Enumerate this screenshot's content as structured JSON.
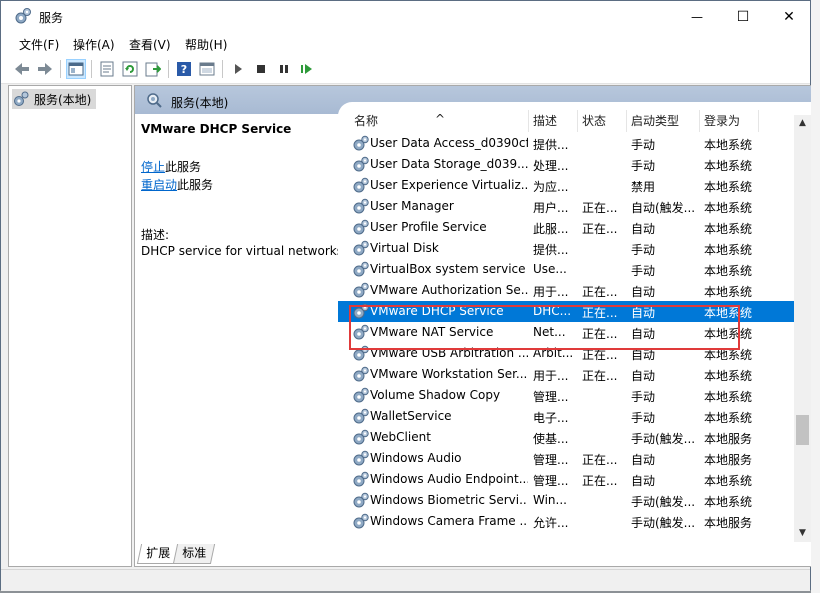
{
  "window": {
    "title": "服务",
    "controls": {
      "minimize": "—",
      "maximize": "☐",
      "close": "✕"
    }
  },
  "menu": [
    "文件(F)",
    "操作(A)",
    "查看(V)",
    "帮助(H)"
  ],
  "toolbar": {
    "icons": [
      "back-icon",
      "forward-icon",
      "show-tree-icon",
      "properties-icon",
      "refresh-icon",
      "export-list-icon",
      "help-icon",
      "console-icon",
      "start-service-icon",
      "stop-service-icon",
      "pause-service-icon",
      "restart-service-icon"
    ]
  },
  "tree": {
    "item": "服务(本地)"
  },
  "pane": {
    "header": "服务(本地)",
    "detail": {
      "service_title": "VMware DHCP Service",
      "stop_link": "停止",
      "stop_suffix": "此服务",
      "restart_link": "重启动",
      "restart_suffix": "此服务",
      "desc_label": "描述:",
      "description": "DHCP service for virtual networks."
    },
    "columns": [
      "名称",
      "描述",
      "状态",
      "启动类型",
      "登录为"
    ],
    "rows": [
      {
        "name": "User Data Access_d0390cf",
        "desc": "提供...",
        "state": "",
        "startup": "手动",
        "logon": "本地系统"
      },
      {
        "name": "User Data Storage_d039...",
        "desc": "处理...",
        "state": "",
        "startup": "手动",
        "logon": "本地系统"
      },
      {
        "name": "User Experience Virtualiz...",
        "desc": "为应...",
        "state": "",
        "startup": "禁用",
        "logon": "本地系统"
      },
      {
        "name": "User Manager",
        "desc": "用户...",
        "state": "正在...",
        "startup": "自动(触发...",
        "logon": "本地系统"
      },
      {
        "name": "User Profile Service",
        "desc": "此服...",
        "state": "正在...",
        "startup": "自动",
        "logon": "本地系统"
      },
      {
        "name": "Virtual Disk",
        "desc": "提供...",
        "state": "",
        "startup": "手动",
        "logon": "本地系统"
      },
      {
        "name": "VirtualBox system service",
        "desc": "Use...",
        "state": "",
        "startup": "手动",
        "logon": "本地系统"
      },
      {
        "name": "VMware Authorization Se...",
        "desc": "用于...",
        "state": "正在...",
        "startup": "自动",
        "logon": "本地系统"
      },
      {
        "name": "VMware DHCP Service",
        "desc": "DHC...",
        "state": "正在...",
        "startup": "自动",
        "logon": "本地系统"
      },
      {
        "name": "VMware NAT Service",
        "desc": "Net...",
        "state": "正在...",
        "startup": "自动",
        "logon": "本地系统"
      },
      {
        "name": "VMware USB Arbitration ...",
        "desc": "Arbit...",
        "state": "正在...",
        "startup": "自动",
        "logon": "本地系统"
      },
      {
        "name": "VMware Workstation Ser...",
        "desc": "用于...",
        "state": "正在...",
        "startup": "自动",
        "logon": "本地系统"
      },
      {
        "name": "Volume Shadow Copy",
        "desc": "管理...",
        "state": "",
        "startup": "手动",
        "logon": "本地系统"
      },
      {
        "name": "WalletService",
        "desc": "电子...",
        "state": "",
        "startup": "手动",
        "logon": "本地系统"
      },
      {
        "name": "WebClient",
        "desc": "使基...",
        "state": "",
        "startup": "手动(触发...",
        "logon": "本地服务"
      },
      {
        "name": "Windows Audio",
        "desc": "管理...",
        "state": "正在...",
        "startup": "自动",
        "logon": "本地服务"
      },
      {
        "name": "Windows Audio Endpoint...",
        "desc": "管理...",
        "state": "正在...",
        "startup": "自动",
        "logon": "本地系统"
      },
      {
        "name": "Windows Biometric Servi...",
        "desc": "Win...",
        "state": "",
        "startup": "手动(触发...",
        "logon": "本地系统"
      },
      {
        "name": "Windows Camera Frame ...",
        "desc": "允许...",
        "state": "",
        "startup": "手动(触发...",
        "logon": "本地服务"
      }
    ],
    "selected_row": 8,
    "tabs": [
      "扩展",
      "标准"
    ],
    "active_tab": 0
  },
  "colors": {
    "selection": "#0078d7",
    "highlight_box": "#e03a3a",
    "link": "#0066cc",
    "pane_header": "#b7c7dc"
  }
}
